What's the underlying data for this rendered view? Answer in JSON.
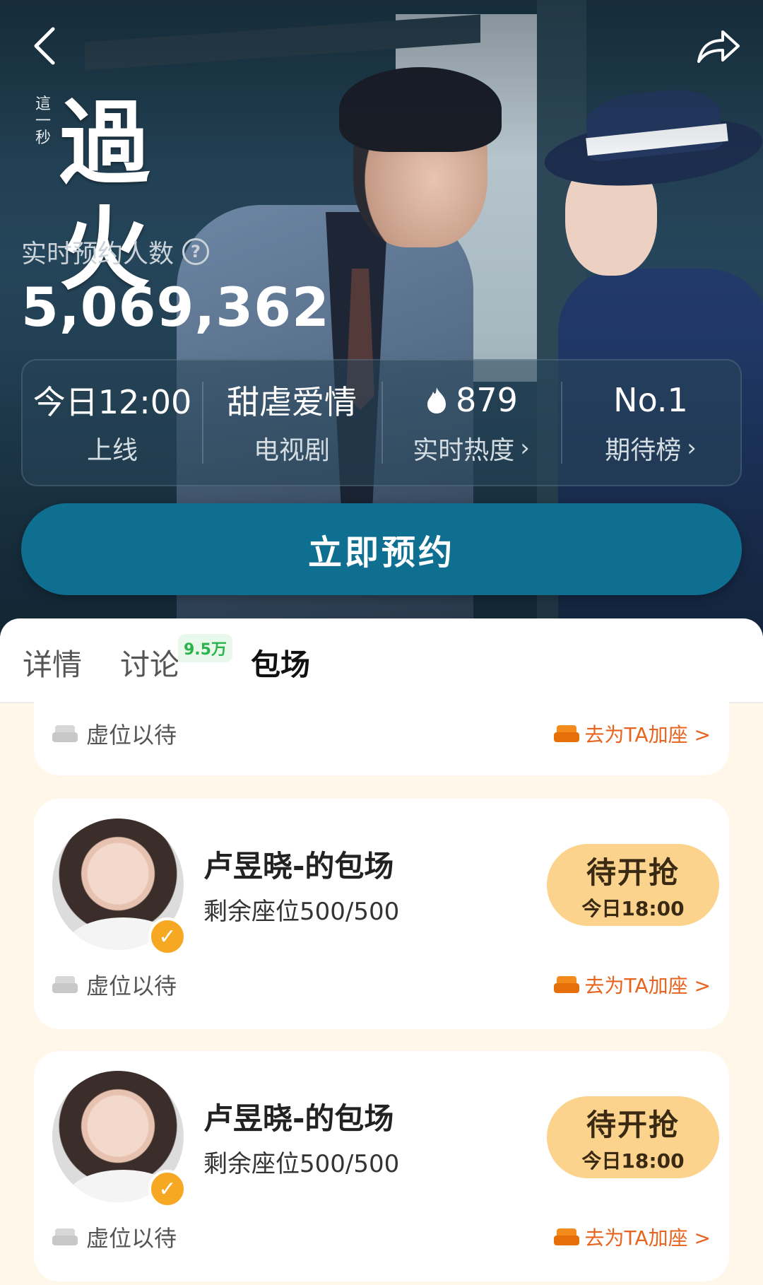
{
  "nav": {
    "back_icon": "back-arrow-icon",
    "share_icon": "share-arrow-icon"
  },
  "show": {
    "logo_small": "這一秒",
    "logo_big": "過火",
    "reservation_label": "实时预约人数",
    "reservation_count": "5,069,362"
  },
  "stats": [
    {
      "value": "今日12:00",
      "label": "上线"
    },
    {
      "value": "甜虐爱情",
      "label": "电视剧"
    },
    {
      "value": "879",
      "label": "实时热度",
      "icon": "flame-icon"
    },
    {
      "value": "No.1",
      "label": "期待榜"
    }
  ],
  "reserve_button": "立即预约",
  "tabs": [
    {
      "label": "详情"
    },
    {
      "label": "讨论",
      "badge": "9.5万"
    },
    {
      "label": "包场",
      "active": true
    }
  ],
  "list": {
    "partial": {
      "waiting": "虚位以待",
      "add_seat": "去为TA加座 >"
    },
    "items": [
      {
        "title": "卢昱晓-的包场",
        "seats": "剩余座位500/500",
        "button_main": "待开抢",
        "button_time": "今日18:00",
        "waiting": "虚位以待",
        "add_seat": "去为TA加座 >"
      },
      {
        "title": "卢昱晓-的包场",
        "seats": "剩余座位500/500",
        "button_main": "待开抢",
        "button_time": "今日18:00",
        "waiting": "虚位以待",
        "add_seat": "去为TA加座 >"
      }
    ]
  },
  "colors": {
    "accent": "#0e6f91",
    "grab_button": "#fcd38d",
    "orange_link": "#e8631d",
    "list_bg": "#fff8ea"
  }
}
